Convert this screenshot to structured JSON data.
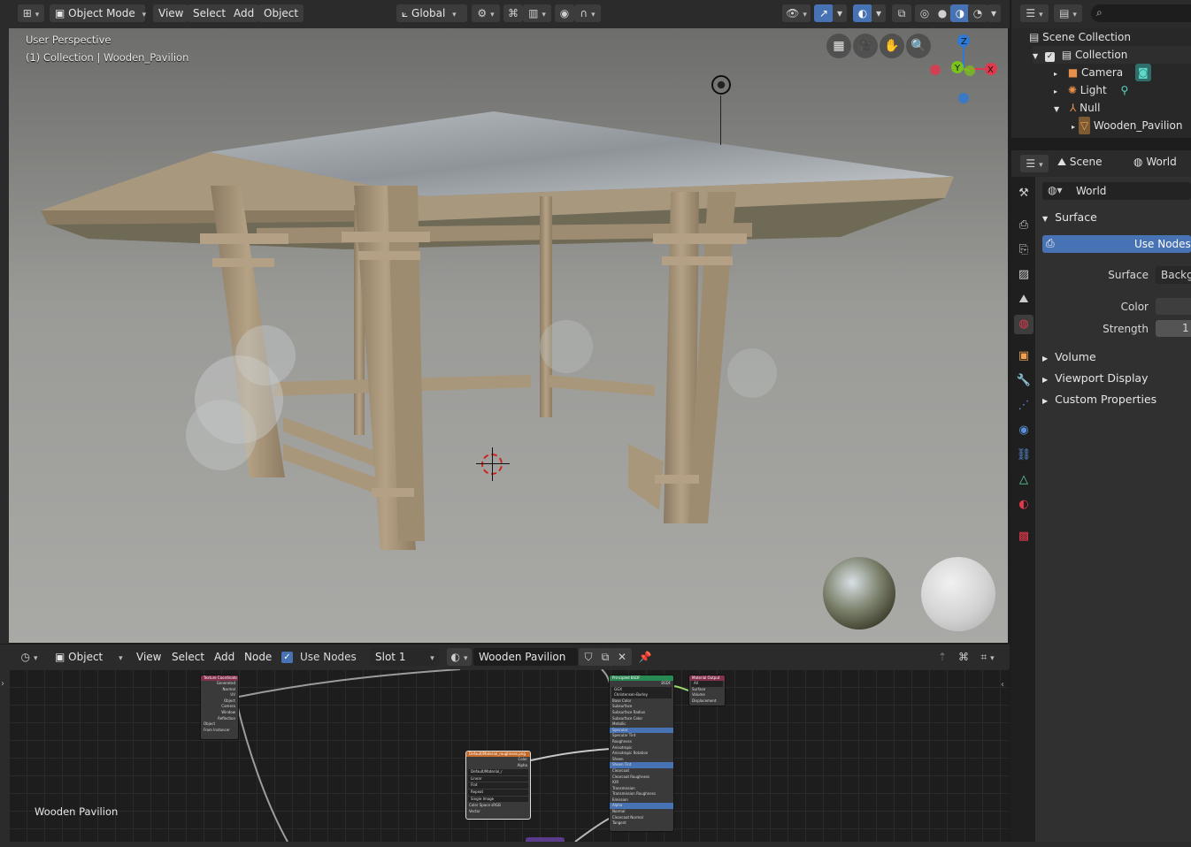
{
  "viewport_header": {
    "mode": "Object Mode",
    "menus": [
      "View",
      "Select",
      "Add",
      "Object"
    ],
    "transform_orientation": "Global"
  },
  "viewport": {
    "perspective_label": "User Perspective",
    "collection_label": "(1) Collection | Wooden_Pavilion"
  },
  "outliner": {
    "items": [
      {
        "label": "Scene Collection",
        "icon": "collection-icon"
      },
      {
        "label": "Collection",
        "icon": "collection-icon"
      },
      {
        "label": "Camera",
        "icon": "camera-icon"
      },
      {
        "label": "Light",
        "icon": "light-icon"
      },
      {
        "label": "Null",
        "icon": "empty-icon"
      },
      {
        "label": "Wooden_Pavilion",
        "icon": "mesh-icon"
      }
    ]
  },
  "properties": {
    "breadcrumb_scene": "Scene",
    "breadcrumb_world": "World",
    "world_field": "World",
    "surface_panel": "Surface",
    "use_nodes": "Use Nodes",
    "surface_label": "Surface",
    "surface_value": "Backgr",
    "color_label": "Color",
    "strength_label": "Strength",
    "strength_value": "1",
    "panels": [
      "Volume",
      "Viewport Display",
      "Custom Properties"
    ]
  },
  "node_editor": {
    "type": "Object",
    "menus": [
      "View",
      "Select",
      "Add",
      "Node"
    ],
    "use_nodes_label": "Use Nodes",
    "slot": "Slot 1",
    "material": "Wooden Pavilion",
    "material_name_label": "Wooden Pavilion",
    "nodes": {
      "texcoord": {
        "title": "Texture Coordinate",
        "rows": [
          "Generated",
          "Normal",
          "UV",
          "Object",
          "Camera",
          "Window",
          "Reflection",
          "Object",
          "From Instancer"
        ]
      },
      "image": {
        "title": "Default/Material_roughness.png",
        "rows": [
          "Color",
          "Alpha",
          "Default/Material_r",
          "Linear",
          "Flat",
          "Repeat",
          "Single Image",
          "Color Space    sRGB",
          "Vector"
        ]
      },
      "bsdf": {
        "title": "Principled BSDF",
        "rows": [
          "BSDF",
          "GGX",
          "Christensen-Burley",
          "Base Color",
          "Subsurface",
          "Subsurface Radius",
          "Subsurface Color",
          "Metallic",
          "Specular",
          "Specular Tint",
          "Roughness",
          "Anisotropic",
          "Anisotropic Rotation",
          "Sheen",
          "Sheen Tint",
          "Clearcoat",
          "Clearcoat Roughness",
          "IOR",
          "Transmission",
          "Transmission Roughness",
          "Emission",
          "Alpha",
          "Normal",
          "Clearcoat Normal",
          "Tangent"
        ]
      },
      "output": {
        "title": "Material Output",
        "rows": [
          "All",
          "Surface",
          "Volume",
          "Displacement"
        ]
      }
    }
  },
  "colors": {
    "accent_blue": "#4772b3",
    "axis_x": "#e0394d",
    "axis_y": "#7ac21c",
    "axis_z": "#2d79d8"
  }
}
